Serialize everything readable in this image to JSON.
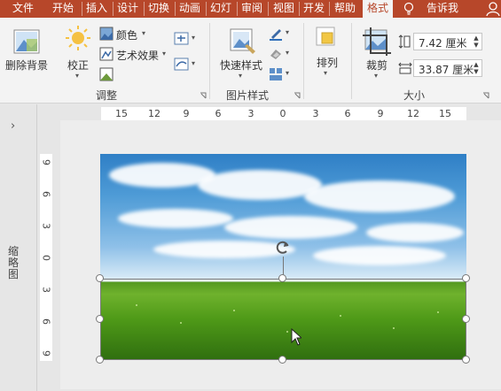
{
  "tabs": [
    {
      "label": "文件"
    },
    {
      "label": "开始"
    },
    {
      "label": "插入"
    },
    {
      "label": "设计"
    },
    {
      "label": "切换"
    },
    {
      "label": "动画"
    },
    {
      "label": "幻灯"
    },
    {
      "label": "审阅"
    },
    {
      "label": "视图"
    },
    {
      "label": "开发"
    },
    {
      "label": "帮助"
    },
    {
      "label": "格式",
      "active": true
    }
  ],
  "tell_me": "告诉我",
  "ribbon": {
    "remove_background": "删除背景",
    "corrections": "校正",
    "color": "颜色",
    "artistic_effects": "艺术效果",
    "adjust_group": "调整",
    "quick_styles": "快速样式",
    "picture_styles_group": "图片样式",
    "arrange": "排列",
    "crop": "裁剪",
    "height_value": "7.42 厘米",
    "width_value": "33.87 厘米",
    "size_group": "大小"
  },
  "pane": {
    "label": "缩略图",
    "chevron": "›"
  },
  "rulers": {
    "horizontal": [
      "15",
      "12",
      "9",
      "6",
      "3",
      "0",
      "3",
      "6",
      "9",
      "12",
      "15"
    ],
    "vertical": [
      "9",
      "6",
      "3",
      "0",
      "3",
      "6",
      "9"
    ]
  },
  "colors": {
    "tab_bar": "#b7472a",
    "ribbon": "#f3f3f3",
    "workspace": "#e6e6e6"
  }
}
